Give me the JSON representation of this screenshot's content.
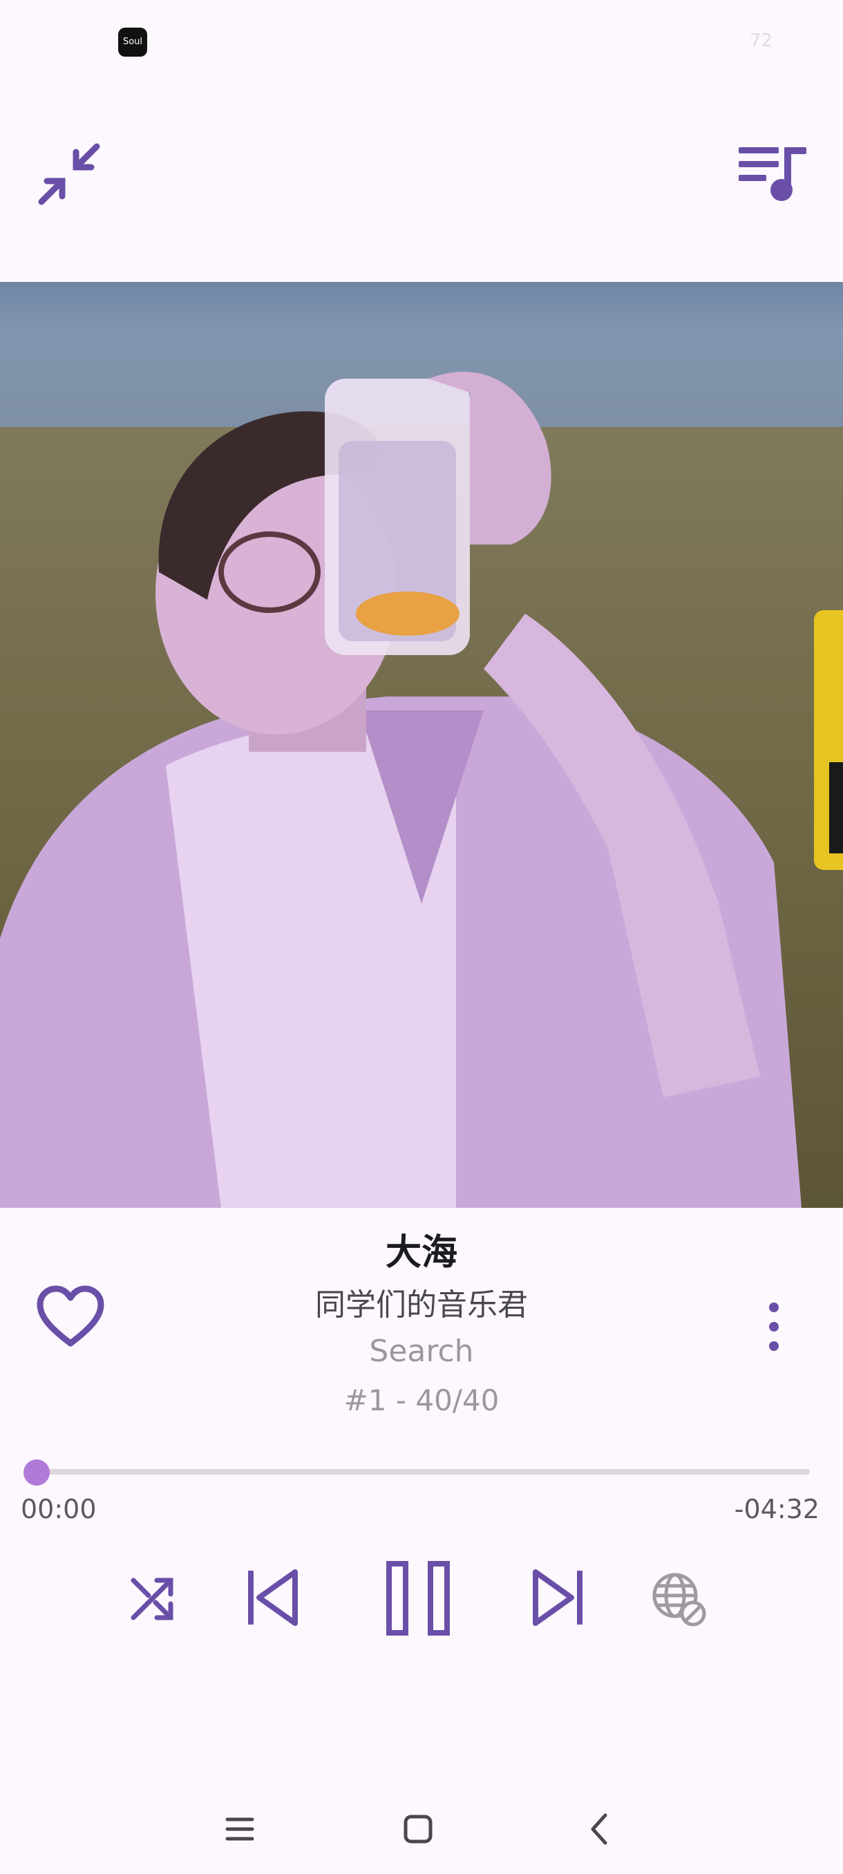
{
  "status_bar": {
    "app_icon": "soul-app-icon",
    "app_icon_text": "Soul",
    "battery": "72"
  },
  "player": {
    "minimize_icon": "collapse-arrows-icon",
    "queue_icon": "queue-music-icon",
    "song_title": "大海",
    "artist": "同学们的音乐君",
    "album": "Search",
    "track_position": "#1 - 40/40",
    "favorite_icon": "heart-outline-icon",
    "more_icon": "more-vert-icon",
    "progress": 0.0,
    "current_time": "00:00",
    "remaining_time": "-04:32",
    "controls": [
      "shuffle-icon",
      "skip-previous-icon",
      "pause-icon",
      "skip-next-icon",
      "lyrics-off-icon"
    ]
  },
  "nav_bar": {
    "items": [
      "menu-icon",
      "home-icon",
      "back-icon"
    ]
  },
  "colors": {
    "accent": "#6a4fa8",
    "progress": "#b07ad9",
    "background": "#fdf8fd",
    "text_primary": "#1c1b1f",
    "text_secondary": "#9b96a0"
  }
}
